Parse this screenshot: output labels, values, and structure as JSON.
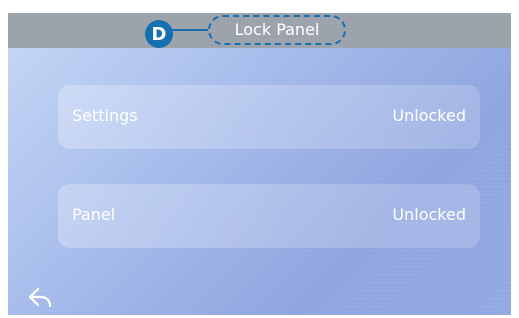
{
  "header": {
    "badge_label": "D",
    "title": "Lock Panel"
  },
  "items": [
    {
      "label": "Settings",
      "value": "Unlocked"
    },
    {
      "label": "Panel",
      "value": "Unlocked"
    }
  ],
  "icons": {
    "back": "back-arrow-icon"
  },
  "colors": {
    "accent": "#1670b0",
    "header_bg": "#9ca2ab",
    "panel_top": "#c6d8f6",
    "panel_bottom": "#8fa5df",
    "text": "#ffffff"
  }
}
